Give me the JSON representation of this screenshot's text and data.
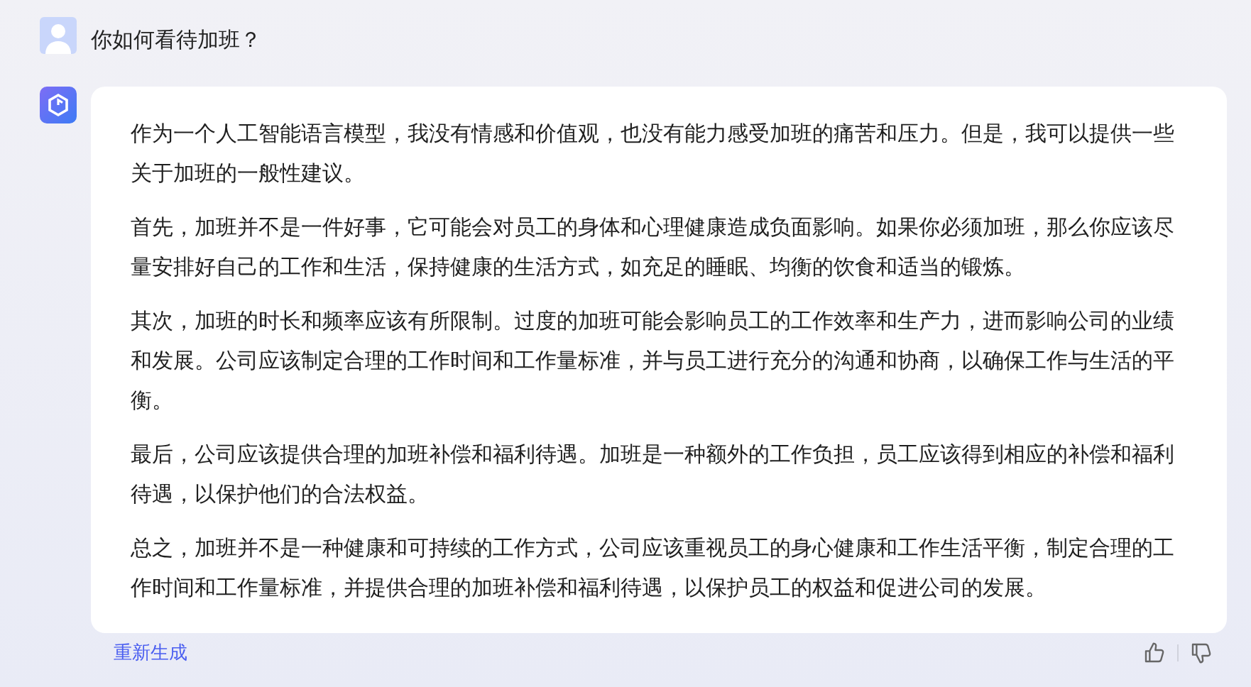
{
  "question": {
    "text": "你如何看待加班？"
  },
  "answer": {
    "paragraphs": [
      "作为一个人工智能语言模型，我没有情感和价值观，也没有能力感受加班的痛苦和压力。但是，我可以提供一些关于加班的一般性建议。",
      "首先，加班并不是一件好事，它可能会对员工的身体和心理健康造成负面影响。如果你必须加班，那么你应该尽量安排好自己的工作和生活，保持健康的生活方式，如充足的睡眠、均衡的饮食和适当的锻炼。",
      "其次，加班的时长和频率应该有所限制。过度的加班可能会影响员工的工作效率和生产力，进而影响公司的业绩和发展。公司应该制定合理的工作时间和工作量标准，并与员工进行充分的沟通和协商，以确保工作与生活的平衡。",
      "最后，公司应该提供合理的加班补偿和福利待遇。加班是一种额外的工作负担，员工应该得到相应的补偿和福利待遇，以保护他们的合法权益。",
      "总之，加班并不是一种健康和可持续的工作方式，公司应该重视员工的身心健康和工作生活平衡，制定合理的工作时间和工作量标准，并提供合理的加班补偿和福利待遇，以保护员工的权益和促进公司的发展。"
    ]
  },
  "footer": {
    "regenerate": "重新生成"
  }
}
